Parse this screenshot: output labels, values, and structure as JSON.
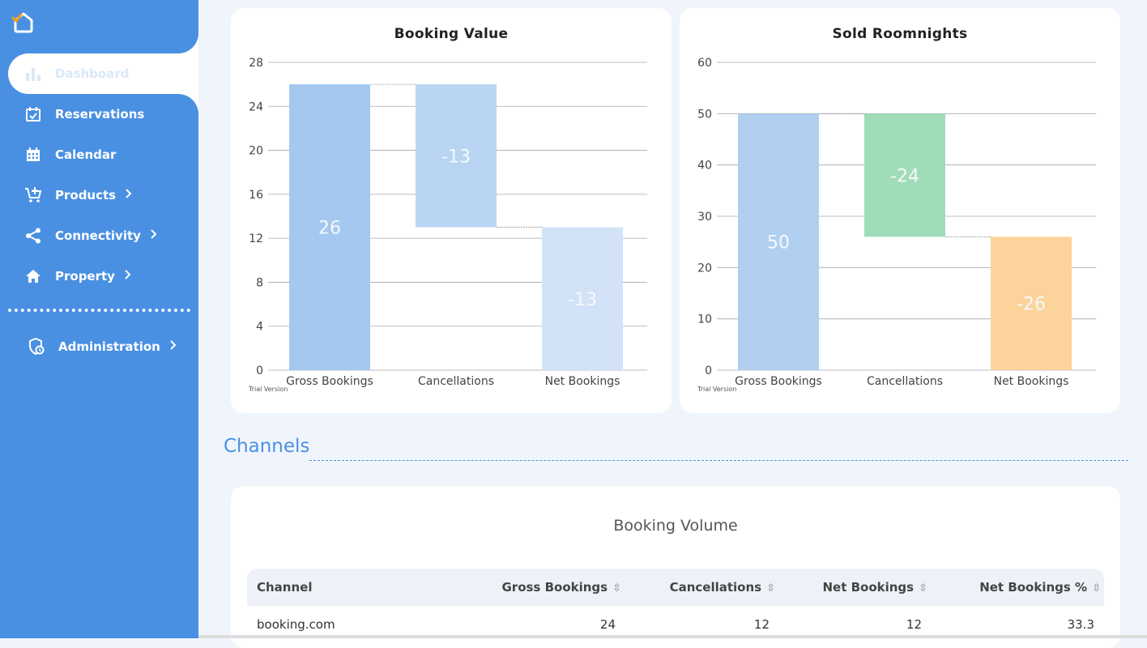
{
  "sidebar": {
    "items": [
      {
        "label": "Dashboard",
        "icon": "bar-chart-icon",
        "active": true
      },
      {
        "label": "Reservations",
        "icon": "calendar-check-icon"
      },
      {
        "label": "Calendar",
        "icon": "calendar-grid-icon"
      },
      {
        "label": "Products",
        "icon": "cart-icon",
        "has_submenu": true
      },
      {
        "label": "Connectivity",
        "icon": "share-icon",
        "has_submenu": true
      },
      {
        "label": "Property",
        "icon": "home-icon",
        "has_submenu": true
      },
      {
        "label": "Administration",
        "icon": "admin-gear-icon",
        "has_submenu": true
      }
    ]
  },
  "charts": {
    "booking_value": {
      "title": "Booking Value",
      "trial": "Trial Version",
      "chart_data": {
        "type": "bar",
        "subtype": "waterfall",
        "title": "Booking Value",
        "categories": [
          "Gross Bookings",
          "Cancellations",
          "Net Bookings"
        ],
        "values": [
          26,
          -13,
          -13
        ],
        "bars": [
          {
            "category": "Gross Bookings",
            "base": 0,
            "top": 26,
            "label": "26",
            "color": "#a4c8ef"
          },
          {
            "category": "Cancellations",
            "base": 13,
            "top": 26,
            "label": "-13",
            "color": "#b9d5f3"
          },
          {
            "category": "Net Bookings",
            "base": 0,
            "top": 13,
            "label": "-13",
            "color": "#d2e3f8"
          }
        ],
        "yticks": [
          "0",
          "4",
          "8",
          "12",
          "16",
          "20",
          "24",
          "28"
        ],
        "ylim": [
          0,
          28
        ],
        "grid": true
      }
    },
    "sold_roomnights": {
      "title": "Sold Roomnights",
      "trial": "Trial Version",
      "chart_data": {
        "type": "bar",
        "subtype": "waterfall",
        "title": "Sold Roomnights",
        "categories": [
          "Gross Bookings",
          "Cancellations",
          "Net Bookings"
        ],
        "values": [
          50,
          -24,
          -26
        ],
        "bars": [
          {
            "category": "Gross Bookings",
            "base": 0,
            "top": 50,
            "label": "50",
            "color": "#b0cff1"
          },
          {
            "category": "Cancellations",
            "base": 26,
            "top": 50,
            "label": "-24",
            "color": "#a0dcb7"
          },
          {
            "category": "Net Bookings",
            "base": 0,
            "top": 26,
            "label": "-26",
            "color": "#fbd39b"
          }
        ],
        "yticks": [
          "0",
          "10",
          "20",
          "30",
          "40",
          "50",
          "60"
        ],
        "ylim": [
          0,
          60
        ],
        "grid": true
      }
    }
  },
  "channels": {
    "section_title": "Channels",
    "table_title": "Booking Volume",
    "columns": [
      "Channel",
      "Gross Bookings",
      "Cancellations",
      "Net Bookings",
      "Net Bookings %"
    ],
    "rows": [
      [
        "booking.com",
        "24",
        "12",
        "12",
        "33.3"
      ]
    ]
  }
}
